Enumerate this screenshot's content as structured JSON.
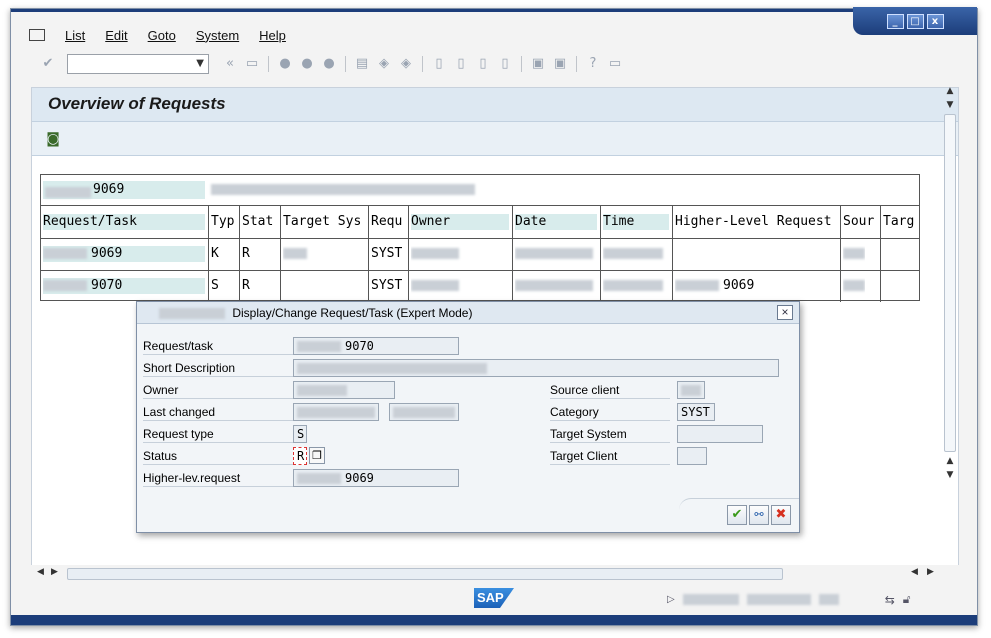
{
  "menu": {
    "items": [
      "List",
      "Edit",
      "Goto",
      "System",
      "Help"
    ]
  },
  "window_controls": [
    "_",
    "□",
    "x"
  ],
  "page": {
    "title": "Overview of Requests"
  },
  "list": {
    "header_request": "9069",
    "columns": [
      "Request/Task",
      "Typ",
      "Stat",
      "Target Sys",
      "Requ",
      "Owner",
      "Date",
      "Time",
      "Higher-Level Request",
      "Sour",
      "Targ"
    ],
    "rows": [
      {
        "request": "9069",
        "typ": "K",
        "stat": "R",
        "requ": "SYST",
        "higher": ""
      },
      {
        "request": "9070",
        "typ": "S",
        "stat": "R",
        "requ": "SYST",
        "higher": "9069"
      }
    ]
  },
  "dialog": {
    "title": "Display/Change Request/Task (Expert Mode)",
    "labels": {
      "request_task": "Request/task",
      "short_description": "Short Description",
      "owner": "Owner",
      "last_changed": "Last changed",
      "request_type": "Request type",
      "status": "Status",
      "higher_lev_request": "Higher-lev.request",
      "source_client": "Source client",
      "category": "Category",
      "target_system": "Target System",
      "target_client": "Target Client"
    },
    "values": {
      "request_task": "9070",
      "request_type": "S",
      "status": "R",
      "higher_lev_request": "9069",
      "category": "SYST"
    }
  },
  "status_bar": {
    "logo": "SAP"
  }
}
